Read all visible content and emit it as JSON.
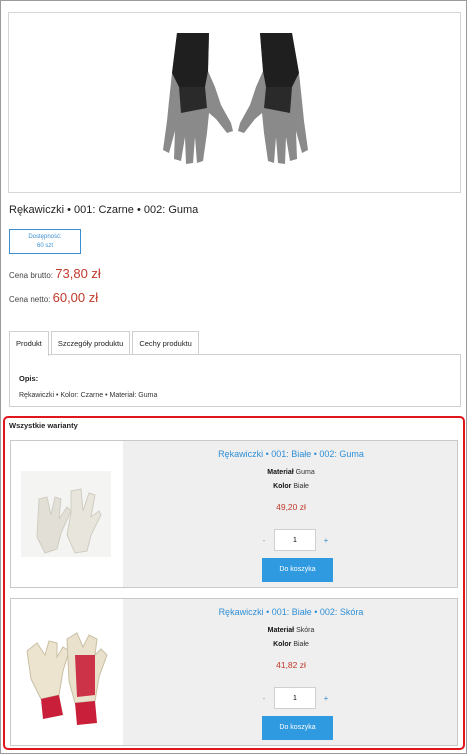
{
  "product": {
    "title": "Rękawiczki • 001: Czarne • 002: Guma",
    "availability_label": "Dostępność:",
    "availability_value": "60 szt",
    "gross_label": "Cena brutto:",
    "gross_value": "73,80 zł",
    "net_label": "Cena netto:",
    "net_value": "60,00 zł"
  },
  "tabs": [
    {
      "label": "Produkt"
    },
    {
      "label": "Szczegóły produktu"
    },
    {
      "label": "Cechy produktu"
    }
  ],
  "description": {
    "label": "Opis:",
    "text": "Rękawiczki • Kolor: Czarne • Materiał: Guma"
  },
  "variants": {
    "title": "Wszystkie warianty",
    "items": [
      {
        "name": "Rękawiczki • 001: Białe • 002: Guma",
        "material_label": "Materiał",
        "material_value": "Guma",
        "color_label": "Kolor",
        "color_value": "Białe",
        "price": "49,20 zł",
        "qty": "1",
        "minus": "-",
        "plus": "+",
        "button": "Do koszyka"
      },
      {
        "name": "Rękawiczki • 001: Białe • 002: Skóra",
        "material_label": "Materiał",
        "material_value": "Skóra",
        "color_label": "Kolor",
        "color_value": "Białe",
        "price": "41,82 zł",
        "qty": "1",
        "minus": "-",
        "plus": "+",
        "button": "Do koszyka"
      }
    ]
  },
  "colors": {
    "accent": "#2f9ae0",
    "price": "#c0392b",
    "highlight_border": "#e0161b"
  }
}
